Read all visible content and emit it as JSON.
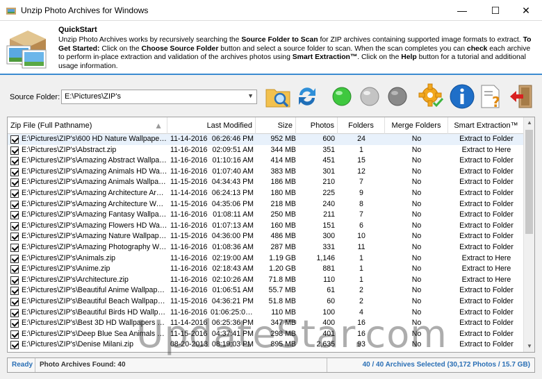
{
  "window": {
    "title": "Unzip Photo Archives for Windows",
    "minimize_glyph": "—",
    "maximize_glyph": "☐",
    "close_glyph": "✕"
  },
  "quickstart": {
    "title": "QuickStart",
    "p1": "Unzip Photo Archives works by recursively searching the ",
    "b1": "Source Folder to Scan",
    "p2": " for ZIP archives containing supported image formats to extract. ",
    "b2": "To Get Started:",
    "p3": " Click on the ",
    "b3": "Choose Source Folder",
    "p4": " button and select a source folder to scan. When the scan completes you can ",
    "b4": "check",
    "p5": " each archive to perform in-place extraction and validation of the archives photos using ",
    "b5": "Smart Extraction™",
    "p6": ". Click on the ",
    "b6": "Help",
    "p7": " button for a tutorial and additional usage information."
  },
  "toolbar": {
    "source_label": "Source Folder:",
    "source_value": "E:\\Pictures\\ZIP's",
    "icons": [
      "folder-search-icon",
      "refresh-icon",
      "green-light-icon",
      "gray-light-icon",
      "dark-gray-light-icon",
      "gear-icon",
      "info-icon",
      "help-document-icon",
      "exit-icon"
    ]
  },
  "table": {
    "columns": [
      "Zip File (Full Pathname)",
      "Last Modified",
      "Size",
      "Photos",
      "Folders",
      "Merge Folders",
      "Smart Extraction™"
    ],
    "rows": [
      [
        "E:\\Pictures\\ZIP's\\600 HD Nature Wallpapers.zip",
        "11-14-2016",
        "06:26:46 PM",
        "952 MB",
        "600",
        "24",
        "No",
        "Extract to Folder"
      ],
      [
        "E:\\Pictures\\ZIP's\\Abstract.zip",
        "11-16-2016",
        "02:09:51 AM",
        "344 MB",
        "351",
        "1",
        "No",
        "Extract to Here"
      ],
      [
        "E:\\Pictures\\ZIP's\\Amazing Abstract Wallpapers.zip",
        "11-16-2016",
        "01:10:16 AM",
        "414 MB",
        "451",
        "15",
        "No",
        "Extract to Folder"
      ],
      [
        "E:\\Pictures\\ZIP's\\Amazing Animals HD Wallpapers.zip",
        "11-16-2016",
        "01:07:40 AM",
        "383 MB",
        "301",
        "12",
        "No",
        "Extract to Folder"
      ],
      [
        "E:\\Pictures\\ZIP's\\Amazing Animals Wallpapers.zip",
        "11-15-2016",
        "04:34:43 PM",
        "186 MB",
        "210",
        "7",
        "No",
        "Extract to Folder"
      ],
      [
        "E:\\Pictures\\ZIP's\\Amazing Architecture Around.zip",
        "11-14-2016",
        "06:24:13 PM",
        "180 MB",
        "225",
        "9",
        "No",
        "Extract to Folder"
      ],
      [
        "E:\\Pictures\\ZIP's\\Amazing Architecture Wallpapers.zip",
        "11-15-2016",
        "04:35:06 PM",
        "218 MB",
        "240",
        "8",
        "No",
        "Extract to Folder"
      ],
      [
        "E:\\Pictures\\ZIP's\\Amazing Fantasy Wallpapers.zip",
        "11-16-2016",
        "01:08:11 AM",
        "250 MB",
        "211",
        "7",
        "No",
        "Extract to Folder"
      ],
      [
        "E:\\Pictures\\ZIP's\\Amazing Flowers HD Wallpapers.zip",
        "11-16-2016",
        "01:07:13 AM",
        "160 MB",
        "151",
        "6",
        "No",
        "Extract to Folder"
      ],
      [
        "E:\\Pictures\\ZIP's\\Amazing Nature Wallpapers.zip",
        "11-15-2016",
        "04:36:00 PM",
        "486 MB",
        "300",
        "10",
        "No",
        "Extract to Folder"
      ],
      [
        "E:\\Pictures\\ZIP's\\Amazing Photography Wallpapers.zip",
        "11-16-2016",
        "01:08:36 AM",
        "287 MB",
        "331",
        "11",
        "No",
        "Extract to Folder"
      ],
      [
        "E:\\Pictures\\ZIP's\\Animals.zip",
        "11-16-2016",
        "02:19:00 AM",
        "1.19 GB",
        "1,146",
        "1",
        "No",
        "Extract to Here"
      ],
      [
        "E:\\Pictures\\ZIP's\\Anime.zip",
        "11-16-2016",
        "02:18:43 AM",
        "1.20 GB",
        "881",
        "1",
        "No",
        "Extract to Here"
      ],
      [
        "E:\\Pictures\\ZIP's\\Architecture.zip",
        "11-16-2016",
        "02:10:26 AM",
        "71.8 MB",
        "110",
        "1",
        "No",
        "Extract to Here"
      ],
      [
        "E:\\Pictures\\ZIP's\\Beautiful Anime Wallpapers.zip",
        "11-16-2016",
        "01:06:51 AM",
        "55.7 MB",
        "61",
        "2",
        "No",
        "Extract to Folder"
      ],
      [
        "E:\\Pictures\\ZIP's\\Beautiful Beach Wallpapers.zip",
        "11-15-2016",
        "04:36:21 PM",
        "51.8 MB",
        "60",
        "2",
        "No",
        "Extract to Folder"
      ],
      [
        "E:\\Pictures\\ZIP's\\Beautiful Birds HD Wallpapers.zip",
        "11-16-2016",
        "01:06:25:05 PM",
        "110 MB",
        "100",
        "4",
        "No",
        "Extract to Folder"
      ],
      [
        "E:\\Pictures\\ZIP's\\Best 3D HD Wallpapers Set.zip",
        "11-14-2016",
        "06:25:36 PM",
        "347 MB",
        "400",
        "16",
        "No",
        "Extract to Folder"
      ],
      [
        "E:\\Pictures\\ZIP's\\Deep Blue Sea Animals Wallpapers.zip",
        "11-15-2016",
        "04:37:41 PM",
        "298 MB",
        "401",
        "16",
        "No",
        "Extract to Folder"
      ],
      [
        "E:\\Pictures\\ZIP's\\Denise Milani.zip",
        "08-20-2013",
        "08:19:03 PM",
        "895 MB",
        "2,635",
        "93",
        "No",
        "Extract to Folder"
      ]
    ]
  },
  "status": {
    "state": "Ready",
    "found": "Photo Archives Found: 40",
    "selected": "40 / 40 Archives Selected (30,172 Photos / 15.7 GB)"
  },
  "watermark": "UpdateStar.com",
  "colors": {
    "accent": "#3a8ad0",
    "status_selected": "#2a6fb5",
    "green": "#3fc83f"
  }
}
